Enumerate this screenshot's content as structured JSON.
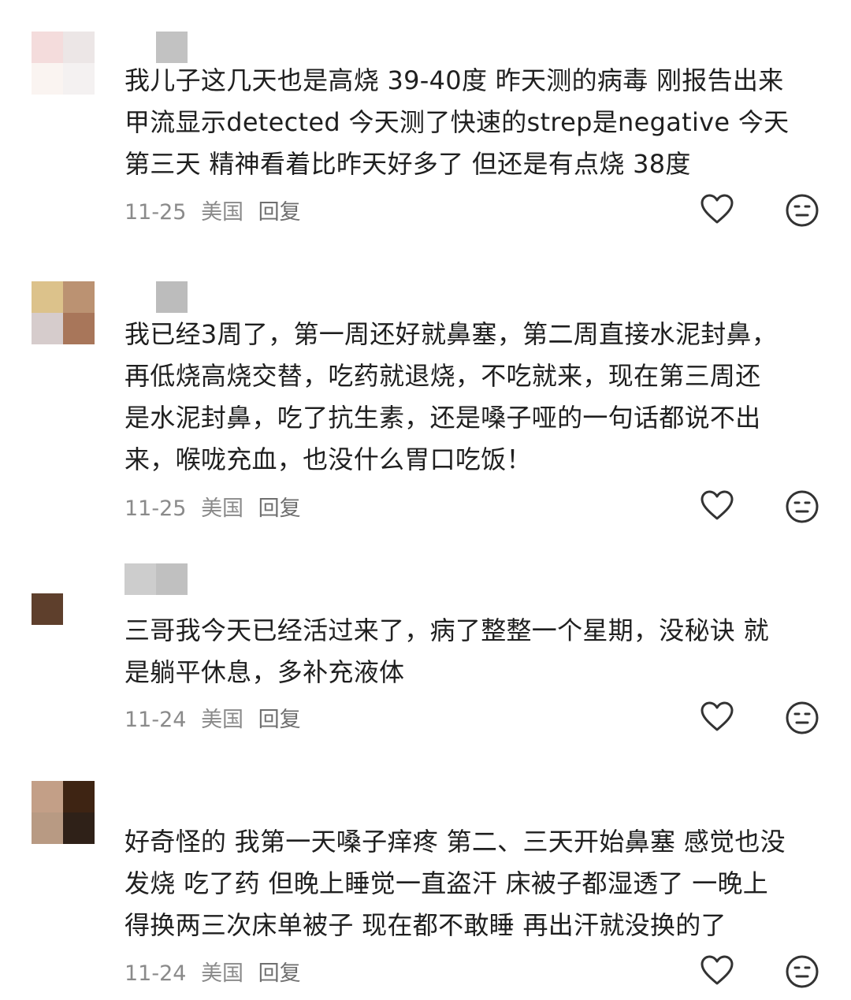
{
  "comments": [
    {
      "lines": [
        "我儿子这几天也是高烧 39-40度 昨天测的病毒 刚报告出来",
        "甲流显示detected  今天测了快速的strep是negative 今天",
        "第三天 精神看着比昨天好多了 但还是有点烧 38度"
      ],
      "date": "11-25",
      "location": "美国",
      "reply_label": "回复",
      "avatar_colors": [
        "#f4dcdc",
        "#ece6e6",
        "#faf4f1",
        "#f4f1f1"
      ],
      "name_colors": [
        "#c2c2c2"
      ]
    },
    {
      "lines": [
        "我已经3周了，第一周还好就鼻塞，第二周直接水泥封鼻，",
        "再低烧高烧交替，吃药就退烧，不吃就来，现在第三周还",
        "是水泥封鼻，吃了抗生素，还是嗓子哑的一句话都说不出",
        "来，喉咙充血，也没什么胃口吃饭！"
      ],
      "date": "11-25",
      "location": "美国",
      "reply_label": "回复",
      "avatar_colors": [
        "#dcc28b",
        "#bb9272",
        "#d6cccc",
        "#a8765a"
      ],
      "name_colors": [
        "#bcbcbc"
      ]
    },
    {
      "lines": [
        "三哥我今天已经活过来了，病了整整一个星期，没秘诀 就",
        "是躺平休息，多补充液体"
      ],
      "date": "11-24",
      "location": "美国",
      "reply_label": "回复",
      "avatar_colors": [
        "#5e3f2c"
      ],
      "name_colors": [
        "#cdcdcd",
        "#c0c0c0"
      ]
    },
    {
      "lines": [
        "好奇怪的 我第一天嗓子痒疼 第二、三天开始鼻塞 感觉也没",
        "发烧 吃了药 但晚上睡觉一直盗汗 床被子都湿透了 一晚上",
        "得换两三次床单被子 现在都不敢睡 再出汗就没换的了"
      ],
      "date": "11-24",
      "location": "美国",
      "reply_label": "回复",
      "avatar_colors": [
        "#c39f87",
        "#3e2413",
        "#b89a83",
        "#2f2118"
      ],
      "name_colors": []
    }
  ],
  "icons": {
    "like": "heart-outline-icon",
    "dislike": "meh-face-icon",
    "icon_color": "#333333"
  }
}
